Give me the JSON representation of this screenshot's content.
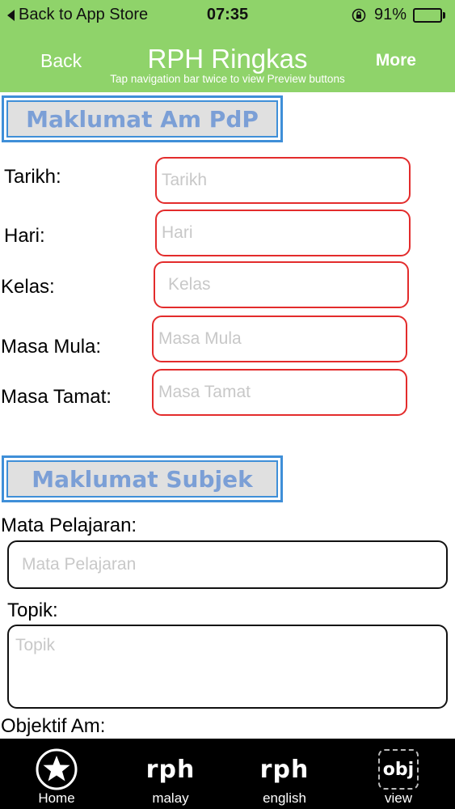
{
  "status_bar": {
    "back_to_app": "Back to App Store",
    "time": "07:35",
    "battery_percent": "91%",
    "battery_level": 0.91
  },
  "nav": {
    "back_label": "Back",
    "title": "RPH Ringkas",
    "more_label": "More",
    "hint": "Tap navigation bar twice to view Preview buttons"
  },
  "section_general": {
    "heading": "Maklumat Am PdP",
    "fields": {
      "tarikh": {
        "label": "Tarikh:",
        "placeholder": "Tarikh"
      },
      "hari": {
        "label": "Hari:",
        "placeholder": "Hari"
      },
      "kelas": {
        "label": "Kelas:",
        "placeholder": "Kelas"
      },
      "masa_mula": {
        "label": "Masa Mula:",
        "placeholder": "Masa Mula"
      },
      "masa_tamat": {
        "label": "Masa Tamat:",
        "placeholder": "Masa Tamat"
      }
    }
  },
  "section_subject": {
    "heading": "Maklumat Subjek",
    "fields": {
      "mata_pelajaran": {
        "label": "Mata Pelajaran:",
        "placeholder": "Mata Pelajaran"
      },
      "topik": {
        "label": "Topik:",
        "placeholder": "Topik"
      },
      "objektif_am": {
        "label": "Objektif Am:"
      }
    }
  },
  "tab_bar": {
    "tabs": [
      {
        "label": "Home",
        "icon": "star-icon"
      },
      {
        "label": "malay",
        "icon": "rph-icon",
        "glyph": "rph"
      },
      {
        "label": "english",
        "icon": "rph-icon",
        "glyph": "rph"
      },
      {
        "label": "view",
        "icon": "obj-icon",
        "glyph": "obj"
      }
    ]
  },
  "colors": {
    "header_green": "#8fd36a",
    "banner_blue": "#3f8fd8",
    "input_border_red": "#e32c2c"
  }
}
